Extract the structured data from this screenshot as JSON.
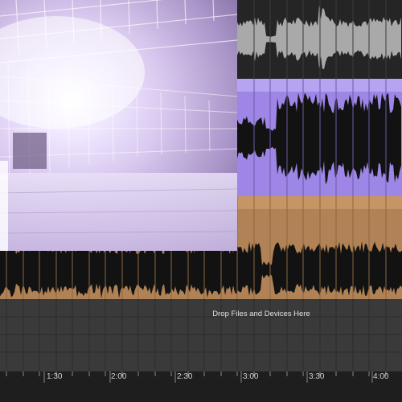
{
  "arrangement": {
    "drop_hint": "Drop Files and Devices Here",
    "time_labels": [
      "1:30",
      "2:00",
      "2:30",
      "3:00",
      "3:30",
      "4:00"
    ]
  },
  "colors": {
    "lane_purple_bg": "#9e86e6",
    "lane_orange_bg": "#b08256",
    "waveform": "#121212",
    "dark_bg": "#2c2c2c",
    "ruler_bg": "#1e1e1e",
    "drop_zone_bg": "#3a3a3a",
    "grid_line": "#555555",
    "playhead_wave": "#b8a8d8"
  },
  "icons": {
    "preview": "video-preview-thumbnail"
  }
}
